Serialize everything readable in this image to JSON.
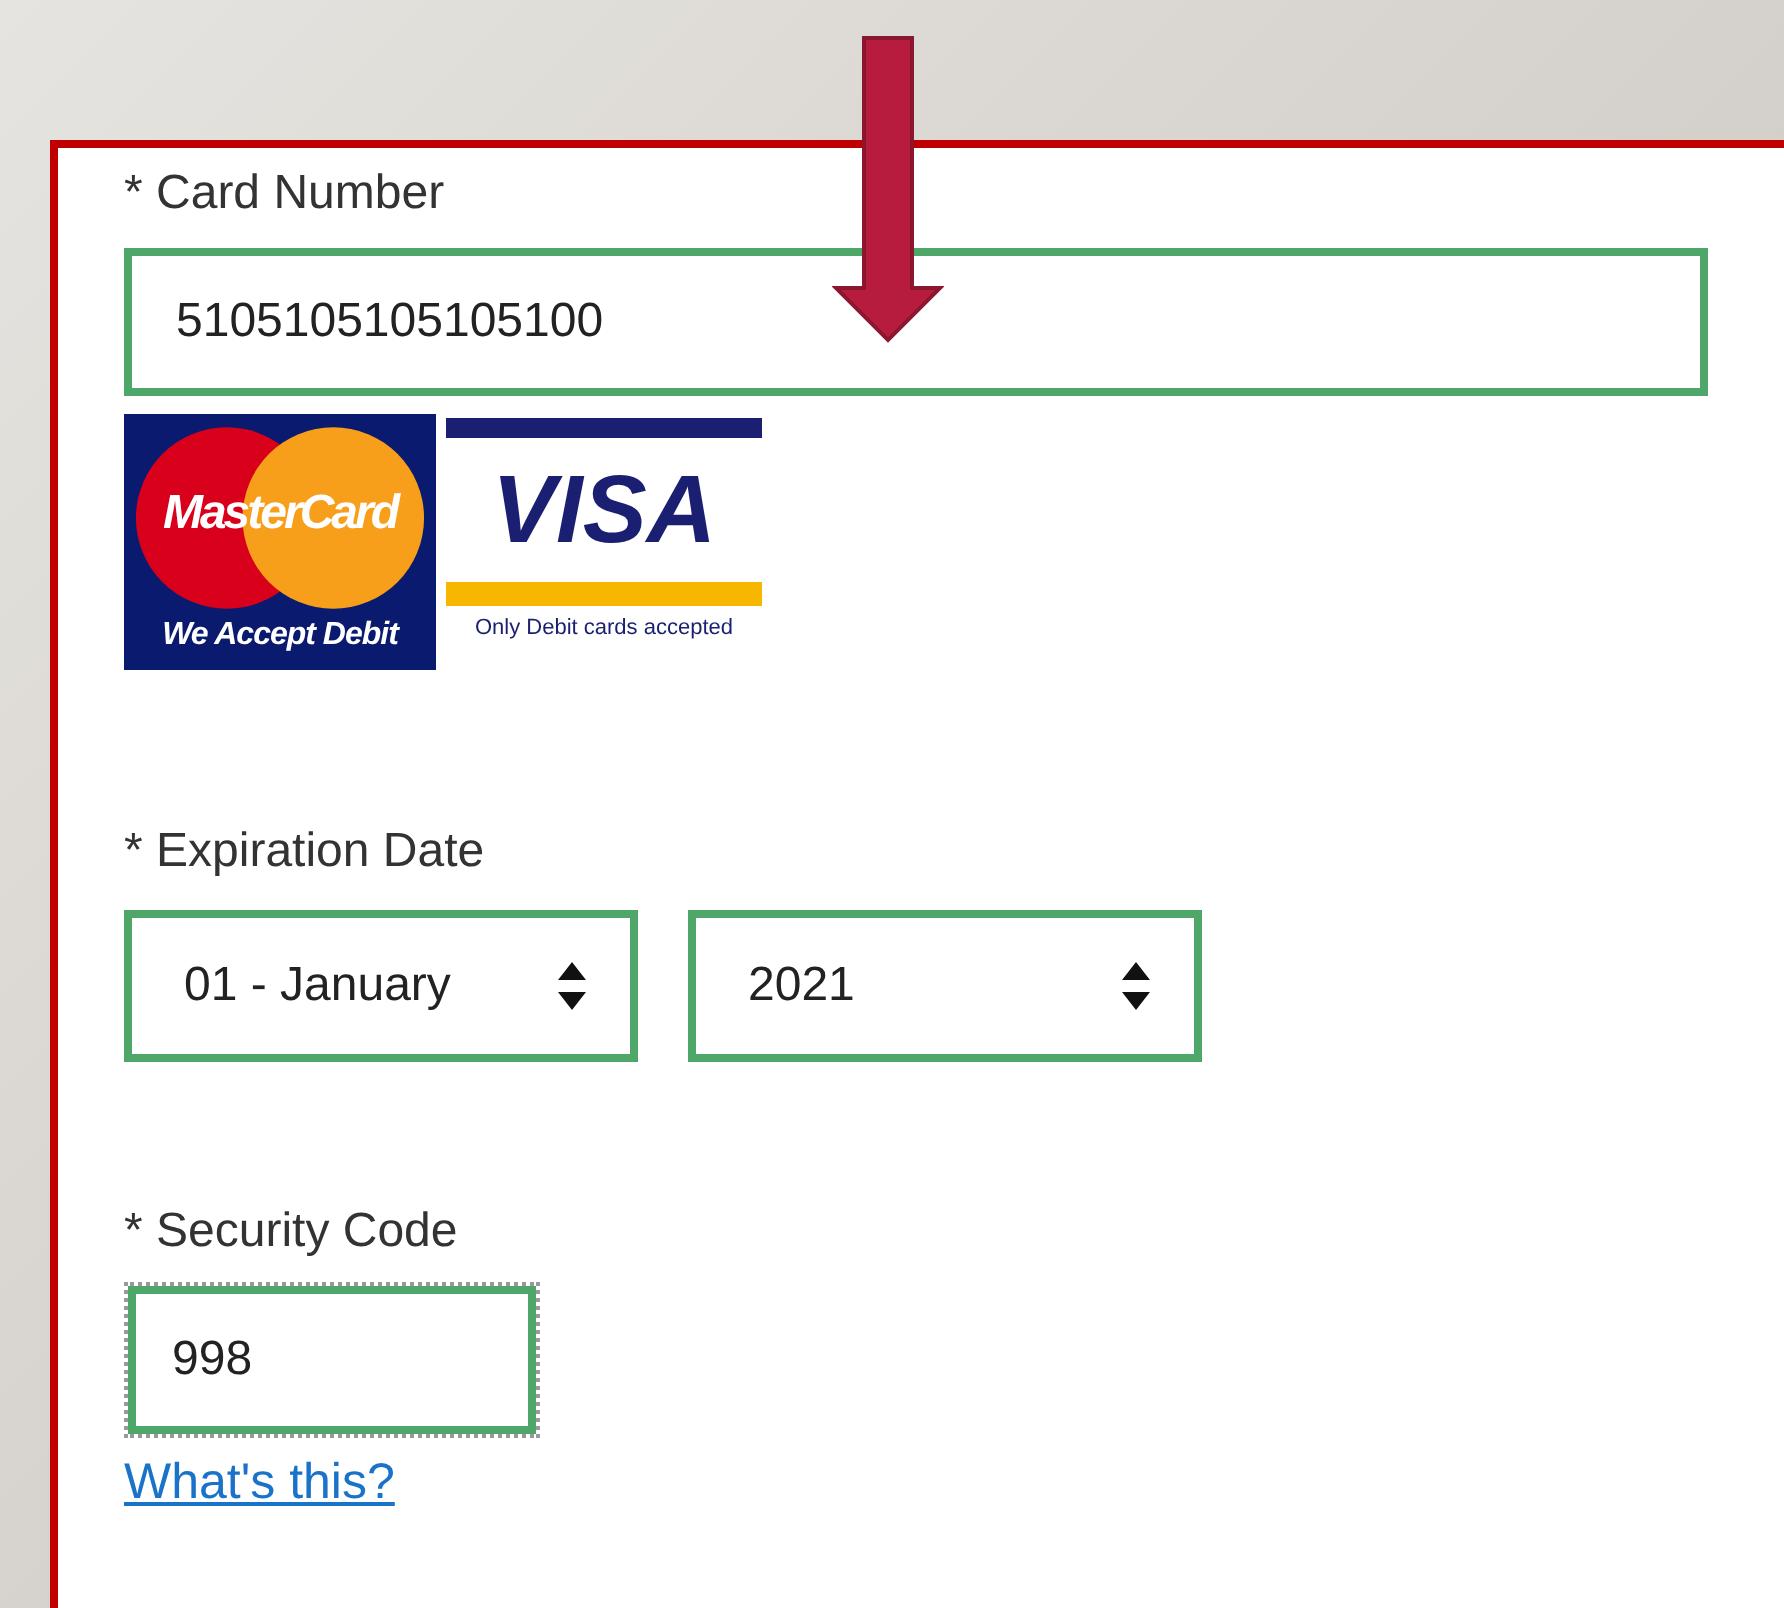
{
  "form": {
    "card_number": {
      "label": "* Card Number",
      "value": "5105105105105100"
    },
    "card_logos": [
      {
        "kind": "mastercard",
        "brand": "MasterCard",
        "caption": "We Accept Debit"
      },
      {
        "kind": "visa",
        "brand": "VISA",
        "caption": "Only Debit cards accepted"
      }
    ],
    "expiration": {
      "label": "* Expiration Date",
      "month": "01 - January",
      "year": "2021"
    },
    "security_code": {
      "label": "* Security Code",
      "value": "998",
      "focused": true
    },
    "help_link": "What's this?"
  }
}
